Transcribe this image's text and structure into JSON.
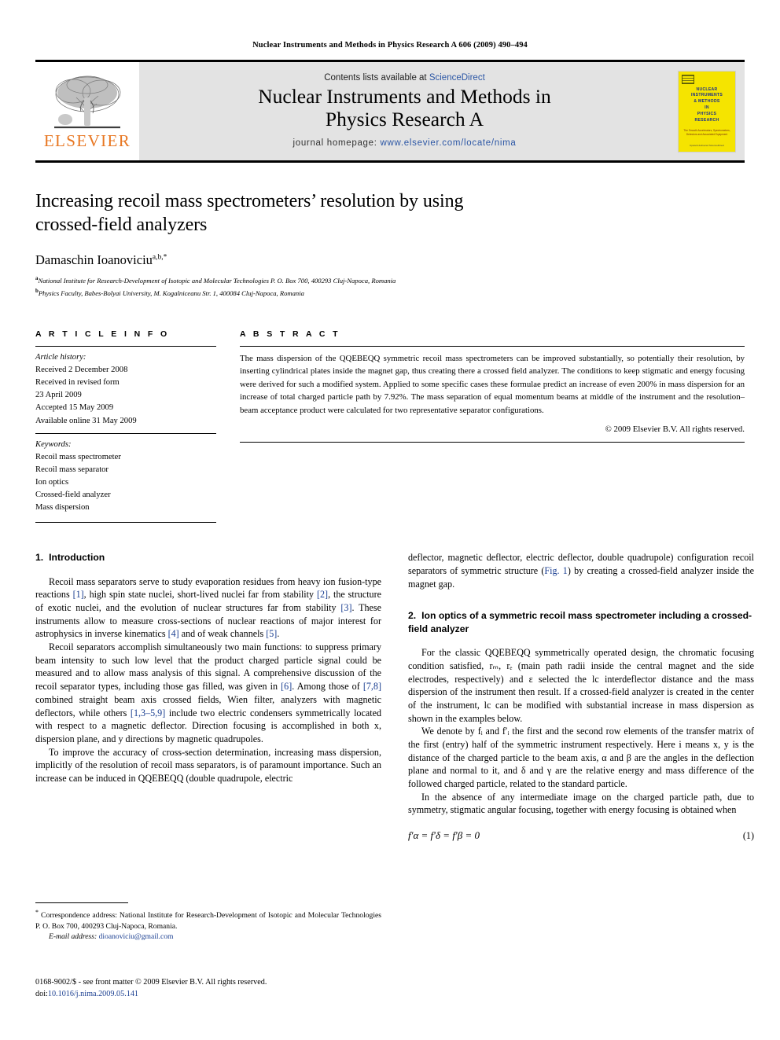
{
  "running_head": "Nuclear Instruments and Methods in Physics Research A 606 (2009) 490–494",
  "masthead": {
    "publisher_name": "ELSEVIER",
    "contents_prefix": "Contents lists available at ",
    "contents_link": "ScienceDirect",
    "journal_title_line1": "Nuclear Instruments and Methods in",
    "journal_title_line2": "Physics Research A",
    "homepage_label": "journal homepage: ",
    "homepage_url": "www.elsevier.com/locate/nima",
    "cover": {
      "title_lines": [
        "NUCLEAR",
        "INSTRUMENTS",
        "& METHODS",
        "IN",
        "PHYSICS",
        "RESEARCH"
      ],
      "subtitle": "The Smooth  Accelerators, Spectrometers, Detectors and Associated Equipment",
      "footer": "Upward delivered ScienceDirect",
      "bg_color": "#f5e400"
    }
  },
  "article": {
    "title_line1": "Increasing recoil mass spectrometers’ resolution by using",
    "title_line2": "crossed-field analyzers",
    "author": "Damaschin Ioanoviciu",
    "author_sup": "a,b,*",
    "affiliations": [
      {
        "marker": "a",
        "text": "National Institute for Research-Development of Isotopic and Molecular Technologies P. O. Box 700, 400293 Cluj-Napoca, Romania"
      },
      {
        "marker": "b",
        "text": "Physics Faculty, Babes-Bolyai University, M. Kogalniceanu Str. 1, 400084 Cluj-Napoca, Romania"
      }
    ]
  },
  "article_info": {
    "heading": "A R T I C L E  I N F O",
    "history_label": "Article history:",
    "history_lines": [
      "Received 2 December 2008",
      "Received in revised form",
      "23 April 2009",
      "Accepted 15 May 2009",
      "Available online 31 May 2009"
    ],
    "keywords_label": "Keywords:",
    "keywords": [
      "Recoil mass spectrometer",
      "Recoil mass separator",
      "Ion optics",
      "Crossed-field analyzer",
      "Mass dispersion"
    ]
  },
  "abstract": {
    "heading": "A B S T R A C T",
    "text": "The mass dispersion of the QQEBEQQ symmetric recoil mass spectrometers can be improved substantially, so potentially their resolution, by inserting cylindrical plates inside the magnet gap, thus creating there a crossed field analyzer. The conditions to keep stigmatic and energy focusing were derived for such a modified system. Applied to some specific cases these formulae predict an increase of even 200% in mass dispersion for an increase of total charged particle path by 7.92%. The mass separation of equal momentum beams at middle of the instrument and the resolution–beam acceptance product were calculated for two representative separator configurations.",
    "copyright": "© 2009 Elsevier B.V. All rights reserved."
  },
  "sections": {
    "intro": {
      "number": "1.",
      "title": "Introduction",
      "p1_a": "Recoil mass separators serve to study evaporation residues from heavy ion fusion-type reactions ",
      "p1_r1": "[1]",
      "p1_b": ", high spin state nuclei, short-lived nuclei far from stability ",
      "p1_r2": "[2]",
      "p1_c": ", the structure of exotic nuclei, and the evolution of nuclear structures far from stability ",
      "p1_r3": "[3]",
      "p1_d": ". These instruments allow to measure cross-sections of nuclear reactions of major interest for astrophysics in inverse kinematics ",
      "p1_r4": "[4]",
      "p1_e": " and of weak channels ",
      "p1_r5": "[5]",
      "p1_f": ".",
      "p2_a": "Recoil separators accomplish simultaneously two main functions: to suppress primary beam intensity to such low level that the product charged particle signal could be measured and to allow mass analysis of this signal. A comprehensive discussion of the recoil separator types, including those gas filled, was given in ",
      "p2_r1": "[6]",
      "p2_b": ". Among those of ",
      "p2_r2": "[7,8]",
      "p2_c": " combined straight beam axis crossed fields, Wien filter, analyzers with magnetic deflectors, while others ",
      "p2_r3": "[1,3–5,9]",
      "p2_d": " include two electric condensers symmetrically located with respect to a magnetic deflector. Direction focusing is accomplished in both x, dispersion plane, and y directions by magnetic quadrupoles.",
      "p3": "To improve the accuracy of cross-section determination, increasing mass dispersion, implicitly of the resolution of recoil mass separators, is of paramount importance. Such an increase can be induced in QQEBEQQ (double quadrupole, electric",
      "p3_cont_a": "deflector, magnetic deflector, electric deflector, double quadrupole) configuration recoil separators of symmetric structure (",
      "p3_cont_ref": "Fig. 1",
      "p3_cont_b": ") by creating a crossed-field analyzer inside the magnet gap."
    },
    "ion_optics": {
      "number": "2.",
      "title": "Ion optics of a symmetric recoil mass spectrometer including a crossed-field analyzer",
      "p1": "For the classic QQEBEQQ symmetrically operated design, the chromatic focusing condition satisfied, rₘ, rₑ (main path radii inside the central magnet and the side electrodes, respectively) and ε selected the lc interdeflector distance and the mass dispersion of the instrument then result. If a crossed-field analyzer is created in the center of the instrument, lc can be modified with substantial increase in mass dispersion as shown in the examples below.",
      "p2": "We denote by fᵢ and f′ᵢ the first and the second row elements of the transfer matrix of the first (entry) half of the symmetric instrument respectively. Here i means x, y is the distance of the charged particle to the beam axis, α and β are the angles in the deflection plane and normal to it, and δ and γ are the relative energy and mass difference of the followed charged particle, related to the standard particle.",
      "p3": "In the absence of any intermediate image on the charged particle path, due to symmetry, stigmatic angular focusing, together with energy focusing is obtained when",
      "equation": "f′α = f′δ = f′β = 0",
      "equation_number": "(1)"
    }
  },
  "footnote": {
    "marker": "*",
    "text": "Correspondence address: National Institute for Research-Development of Isotopic and Molecular Technologies P. O. Box 700, 400293 Cluj-Napoca, Romania.",
    "email_label": "E-mail address: ",
    "email": "dioanoviciu@gmail.com"
  },
  "issn_line": "0168-9002/$ - see front matter © 2009 Elsevier B.V. All rights reserved.",
  "doi_label": "doi:",
  "doi_value": "10.1016/j.nima.2009.05.141",
  "colors": {
    "link_blue": "#2b56a5",
    "ref_blue": "#1b3f91",
    "elsevier_orange": "#E87722",
    "masthead_gray": "#e3e3e3"
  }
}
